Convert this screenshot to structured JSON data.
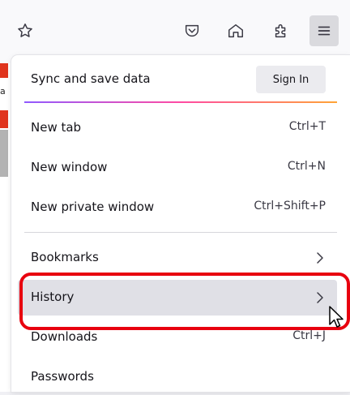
{
  "toolbar": {
    "icons": [
      "star-icon",
      "pocket-icon",
      "home-icon",
      "extensions-icon",
      "hamburger-menu-icon"
    ]
  },
  "page_strip": {
    "glyph": "a"
  },
  "menu": {
    "sync_label": "Sync and save data",
    "sign_in_label": "Sign In",
    "items": [
      {
        "label": "New tab",
        "shortcut": "Ctrl+T"
      },
      {
        "label": "New window",
        "shortcut": "Ctrl+N"
      },
      {
        "label": "New private window",
        "shortcut": "Ctrl+Shift+P"
      },
      {
        "label": "Bookmarks",
        "submenu": true
      },
      {
        "label": "History",
        "submenu": true,
        "hovered": true
      },
      {
        "label": "Downloads",
        "shortcut": "Ctrl+J"
      },
      {
        "label": "Passwords"
      }
    ]
  },
  "colors": {
    "highlight": "#e8000f",
    "sync_gradient": [
      "#9059ff",
      "#ff4aa2",
      "#ffa436"
    ]
  }
}
